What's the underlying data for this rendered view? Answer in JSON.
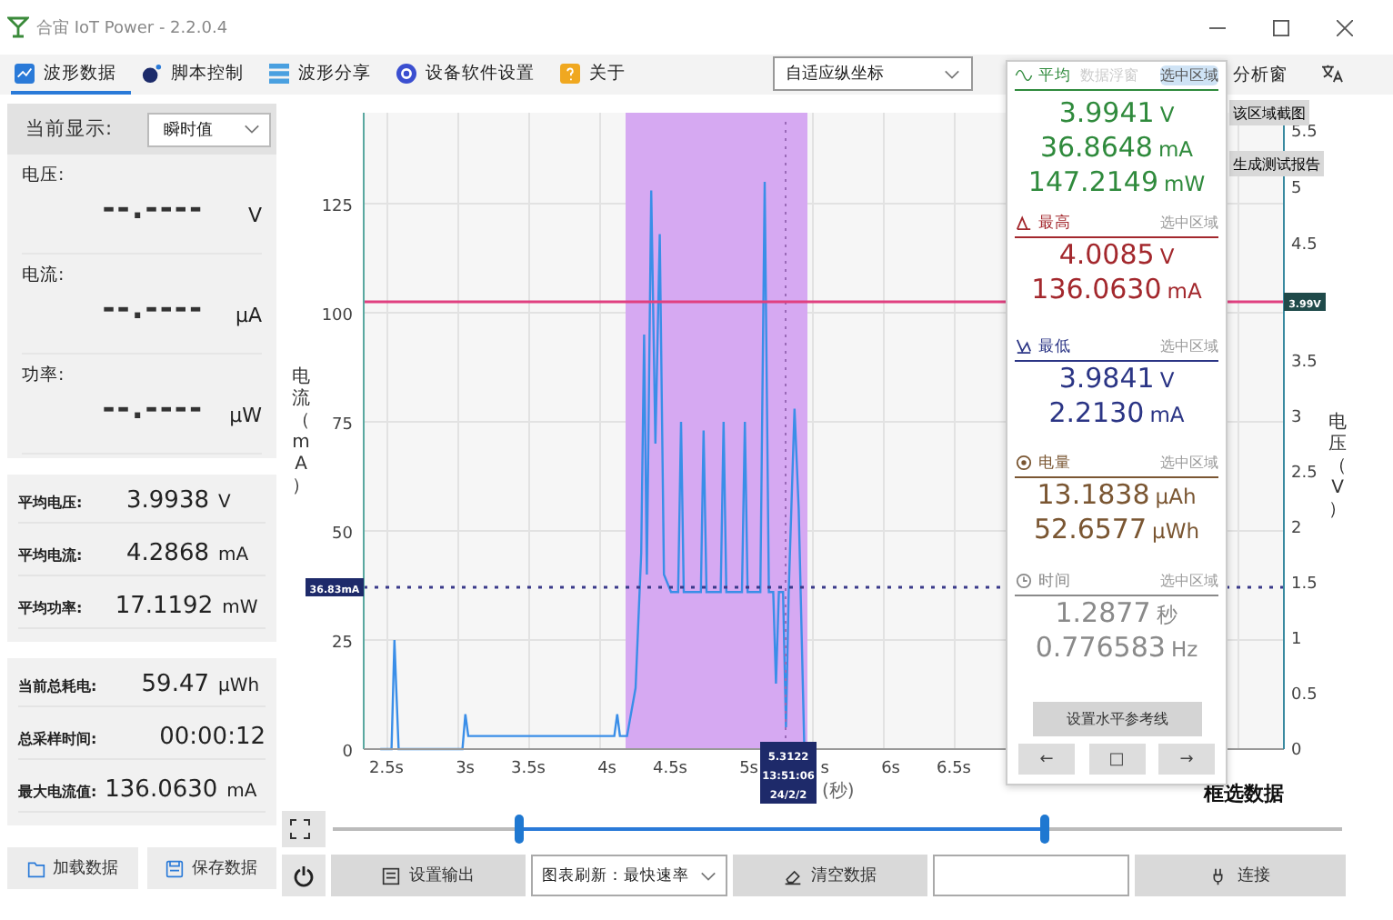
{
  "window": {
    "title": "合宙 IoT Power - 2.2.0.4"
  },
  "tabs": [
    {
      "label": "波形数据",
      "selected": true
    },
    {
      "label": "脚本控制",
      "selected": false
    },
    {
      "label": "波形分享",
      "selected": false
    },
    {
      "label": "设备软件设置",
      "selected": false
    },
    {
      "label": "关于",
      "selected": false
    }
  ],
  "toolbar": {
    "axis_mode": "自适应纵坐标",
    "float_window_label": "数据浮窗",
    "analysis_label": "分析窗"
  },
  "left_panel": {
    "display_label": "当前显示:",
    "display_mode": "瞬时值",
    "readings": [
      {
        "label": "电压:",
        "value": "--.----",
        "unit": "V"
      },
      {
        "label": "电流:",
        "value": "--.----",
        "unit": "μA"
      },
      {
        "label": "功率:",
        "value": "--.----",
        "unit": "μW"
      }
    ],
    "averages": [
      {
        "label": "平均电压:",
        "value": "3.9938",
        "unit": "V"
      },
      {
        "label": "平均电流:",
        "value": "4.2868",
        "unit": "mA"
      },
      {
        "label": "平均功率:",
        "value": "17.1192",
        "unit": "mW"
      }
    ],
    "totals": [
      {
        "label": "当前总耗电:",
        "value": "59.47",
        "unit": "μWh"
      },
      {
        "label": "总采样时间:",
        "value": "00:00:12"
      },
      {
        "label": "最大电流值:",
        "value": "136.0630",
        "unit": "mA"
      }
    ],
    "buttons": [
      "加载数据",
      "保存数据"
    ]
  },
  "chart": {
    "y_label": "电流（mA）",
    "y_ticks": [
      "125",
      "100",
      "75",
      "50",
      "25",
      "0"
    ],
    "x_ticks": [
      "2.5s",
      "3s",
      "3.5s",
      "4s",
      "4.5s",
      "5s",
      "s",
      "6s",
      "6.5s"
    ],
    "x_unit": "(秒)",
    "y2_label": "电压（V）",
    "y2_ticks_lower": [
      "3.5",
      "3",
      "2.5",
      "2",
      "1.5",
      "1",
      "0.5",
      "0"
    ],
    "y2_ticks_upper": [
      "5.5",
      "5",
      "4.5"
    ],
    "reference_tag": "36.83mA",
    "voltage_tag": "3.99V",
    "cursor_tag": [
      "5.3122",
      "13:51:06",
      "24/2/2"
    ],
    "caption": "框选数据",
    "actions": [
      "该区域截图",
      "生成测试报告"
    ]
  },
  "float_panel": {
    "sections": [
      {
        "title": "平均",
        "scope": "选中区域",
        "color": "#2f8a3c",
        "values": [
          {
            "value": "3.9941",
            "unit": "V"
          },
          {
            "value": "36.8648",
            "unit": "mA"
          },
          {
            "value": "147.2149",
            "unit": "mW"
          }
        ]
      },
      {
        "title": "最高",
        "scope": "选中区域",
        "color": "#a3282d",
        "values": [
          {
            "value": "4.0085",
            "unit": "V"
          },
          {
            "value": "136.0630",
            "unit": "mA"
          }
        ]
      },
      {
        "title": "最低",
        "scope": "选中区域",
        "color": "#2b3585",
        "values": [
          {
            "value": "3.9841",
            "unit": "V"
          },
          {
            "value": "2.2130",
            "unit": "mA"
          }
        ]
      },
      {
        "title": "电量",
        "scope": "选中区域",
        "color": "#7a5632",
        "values": [
          {
            "value": "13.1838",
            "unit": "μAh"
          },
          {
            "value": "52.6577",
            "unit": "μWh"
          }
        ]
      },
      {
        "title": "时间",
        "scope": "选中区域",
        "color": "#8a8a8a",
        "values": [
          {
            "value": "1.2877",
            "unit": "秒"
          },
          {
            "value": "0.776583",
            "unit": "Hz"
          }
        ]
      }
    ],
    "button": "设置水平参考线",
    "nav": [
      "←",
      "□",
      "→"
    ]
  },
  "slider": {
    "thumbs": [
      {
        "level": 0.184
      },
      {
        "level": 0.705
      }
    ]
  },
  "bottom_bar": {
    "output_button": "设置输出",
    "refresh": "图表刷新：最快速率",
    "clear_button": "清空数据",
    "connect_button": "连接"
  }
}
